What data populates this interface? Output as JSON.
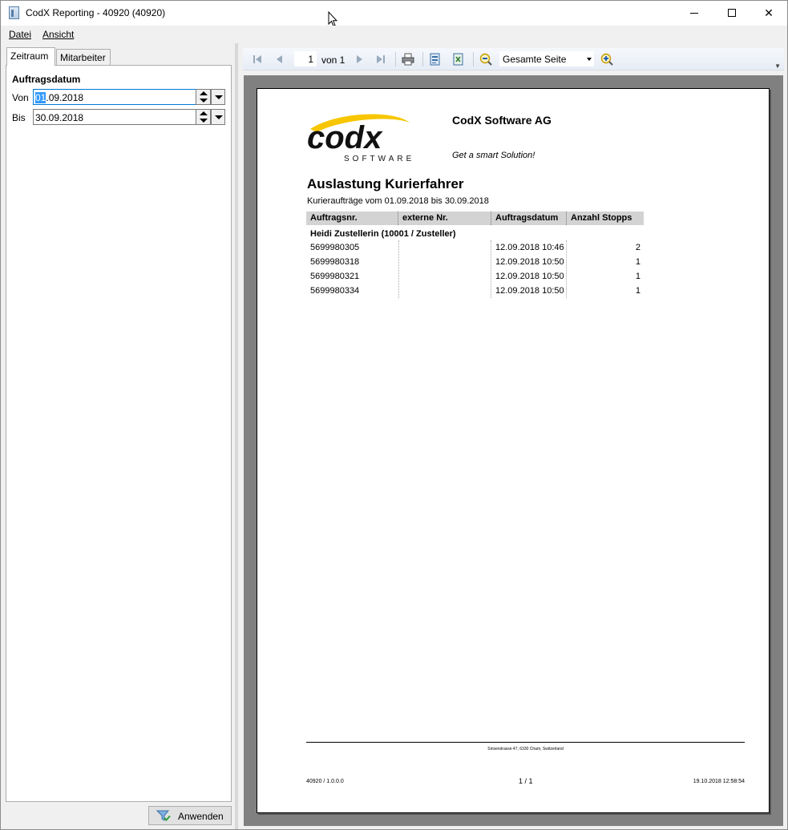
{
  "window": {
    "title": "CodX Reporting - 40920 (40920)",
    "minimize": "minimize",
    "maximize": "maximize",
    "close": "✕"
  },
  "menu": {
    "file": "Datei",
    "view": "Ansicht"
  },
  "left": {
    "tabs": [
      {
        "label": "Zeitraum",
        "active": true
      },
      {
        "label": "Mitarbeiter",
        "active": false
      }
    ],
    "group_label": "Auftragsdatum",
    "from_label": "Von",
    "from_value_selected": "01",
    "from_value_rest": ".09.2018",
    "to_label": "Bis",
    "to_value": "30.09.2018",
    "apply_label": "Anwenden"
  },
  "toolbar": {
    "page_current": "1",
    "page_of": "von 1",
    "zoom_mode": "Gesamte Seite",
    "icons": [
      "first-page-icon",
      "prev-page-icon",
      "next-page-icon",
      "last-page-icon",
      "print-icon",
      "export-icon",
      "export-excel-icon",
      "zoom-out-icon",
      "zoom-in-icon"
    ]
  },
  "report": {
    "company": "CodX Software AG",
    "tagline": "Get a smart Solution!",
    "logo_text": "codx",
    "logo_subtext": "SOFTWARE",
    "title": "Auslastung Kurierfahrer",
    "subtitle": "Kurieraufträge vom 01.09.2018 bis 30.09.2018",
    "columns": [
      "Auftragsnr.",
      "externe Nr.",
      "Auftragsdatum",
      "Anzahl Stopps"
    ],
    "group": "Heidi Zustellerin (10001 / Zusteller)",
    "rows": [
      {
        "order": "5699980305",
        "ext": "",
        "date": "12.09.2018 10:46",
        "stops": "2"
      },
      {
        "order": "5699980318",
        "ext": "",
        "date": "12.09.2018 10:50",
        "stops": "1"
      },
      {
        "order": "5699980321",
        "ext": "",
        "date": "12.09.2018 10:50",
        "stops": "1"
      },
      {
        "order": "5699980334",
        "ext": "",
        "date": "12.09.2018 10:50",
        "stops": "1"
      }
    ],
    "footer_address": "Sinserstrasse 47, 6330 Cham, Switzerland",
    "footer_version": "40920 / 1.0.0.0",
    "footer_page": "1 / 1",
    "footer_date": "19.10.2018 12:58:54"
  },
  "colors": {
    "accent": "#0078d7",
    "selection": "#3399ff",
    "logo_yellow": "#f7c600"
  }
}
